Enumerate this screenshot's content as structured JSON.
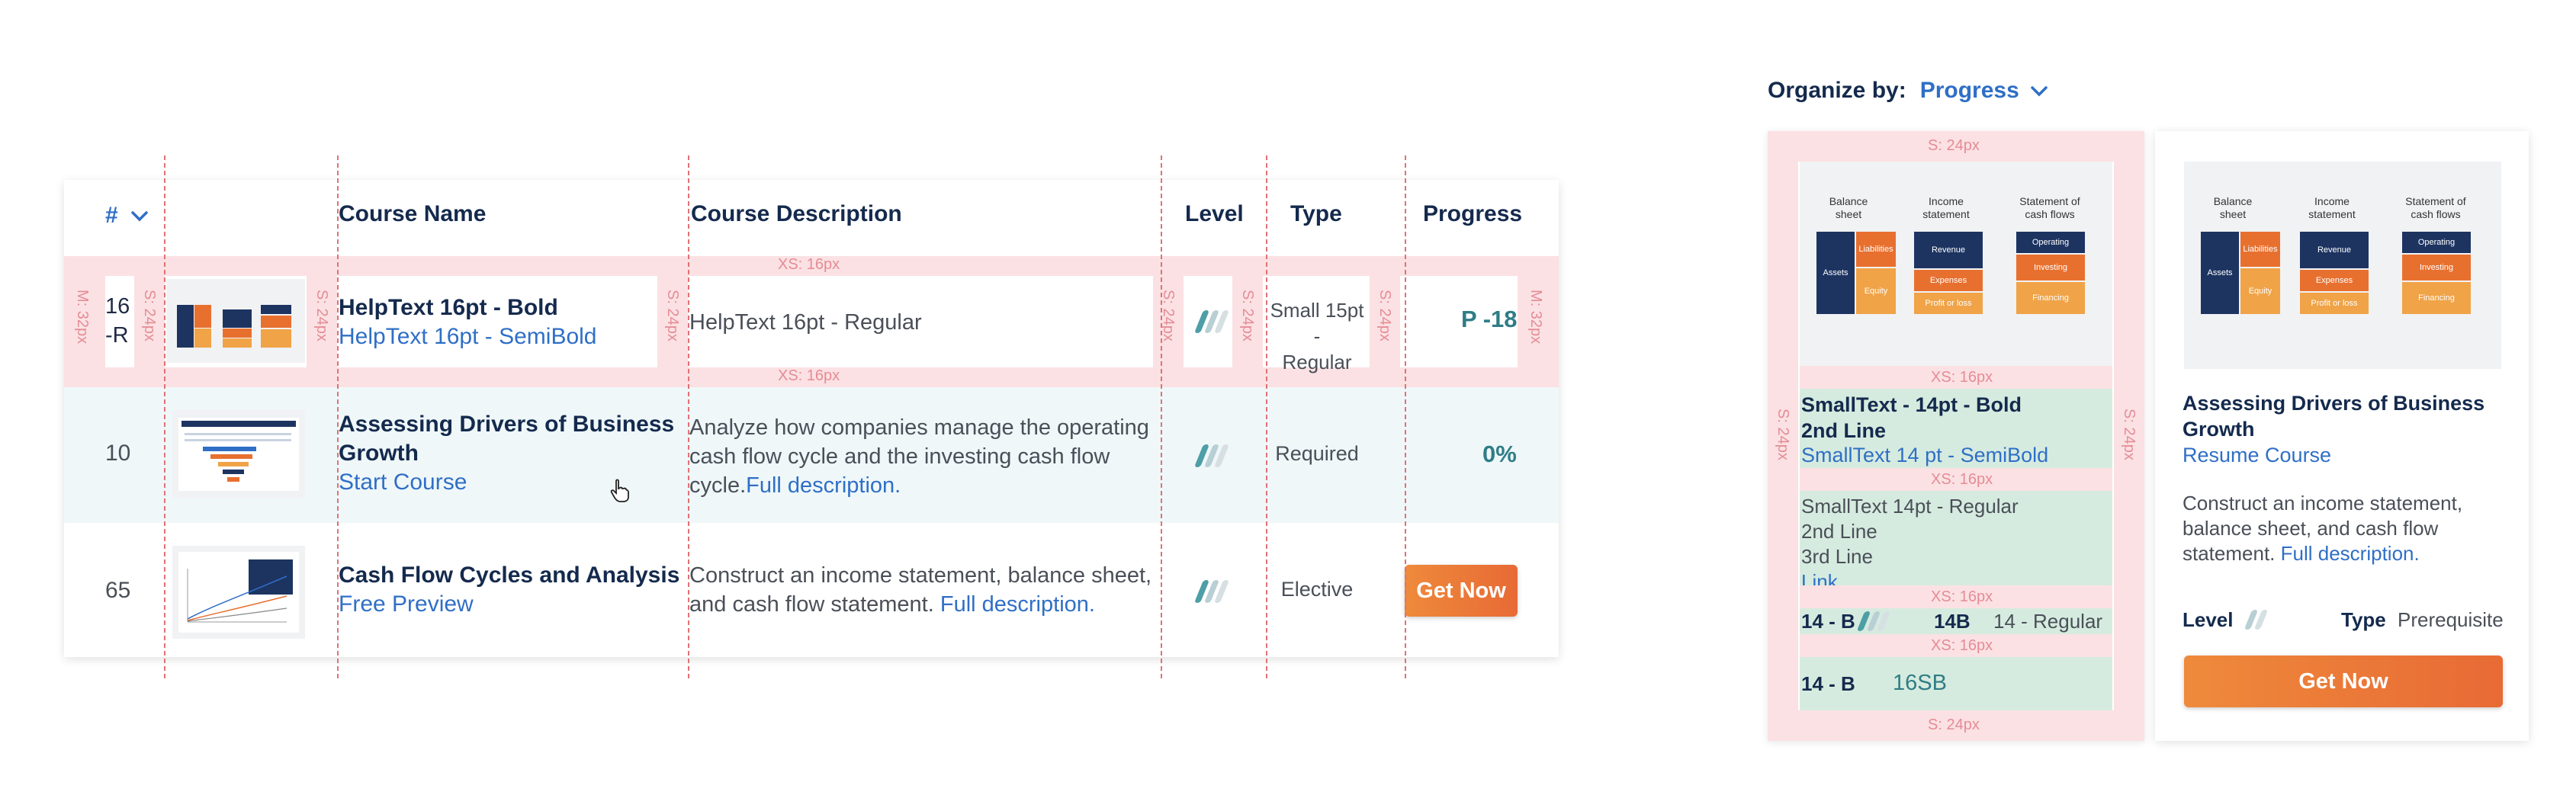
{
  "table": {
    "headers": {
      "index": "#",
      "course_name": "Course Name",
      "description": "Course Description",
      "level": "Level",
      "type": "Type",
      "progress": "Progress"
    },
    "spec_row": {
      "index_line1": "16",
      "index_line2": "-R",
      "name_bold": "HelpText 16pt - Bold",
      "name_link": "HelpText 16pt - SemiBold",
      "description": "HelpText 16pt - Regular",
      "type_line1": "Small 15pt -",
      "type_line2": "Regular",
      "progress": "P -18"
    },
    "rows": [
      {
        "index": "10",
        "title_line1": "Assessing Drivers of Business",
        "title_line2": "Growth",
        "link": "Start Course",
        "desc_line1": "Analyze how companies manage the operating",
        "desc_line2": "cash flow cycle and the investing cash flow",
        "desc_line3": "cycle.",
        "desc_link": "Full description.",
        "type": "Required",
        "progress": "0%"
      },
      {
        "index": "65",
        "title": "Cash Flow Cycles and Analysis",
        "link": "Free Preview",
        "desc_line1": "Construct an income statement, balance sheet,",
        "desc_line2": "and cash flow statement.",
        "desc_link": "Full description.",
        "type": "Elective",
        "button": "Get Now"
      }
    ]
  },
  "spacers": {
    "xs16": "XS: 16px",
    "s24": "S: 24px",
    "m32": "M: 32px"
  },
  "organize": {
    "label": "Organize by:",
    "value": "Progress"
  },
  "thumb_labels": {
    "balance": "Balance sheet",
    "income": "Income statement",
    "cashflows": "Statement of cash flows",
    "assets": "Assets",
    "liabilities": "Liabilities",
    "equity": "Equity",
    "revenue": "Revenue",
    "expenses": "Expenses",
    "profit": "Profit or loss",
    "operating": "Operating",
    "investing": "Investing",
    "financing": "Financing"
  },
  "spec_card": {
    "title_line1": "SmallText - 14pt - Bold",
    "title_line2": "2nd Line",
    "link": "SmallText 14 pt - SemiBold",
    "body_line1": "SmallText 14pt - Regular",
    "body_line2": "2nd Line",
    "body_line3": "3rd Line",
    "body_link": "Link",
    "meta_b1": "14 - B",
    "meta_b2": "14B",
    "meta_r": "14 - Regular",
    "foot_b": "14 - B",
    "foot_sb": "16SB"
  },
  "card": {
    "title_line1": "Assessing Drivers of Business",
    "title_line2": "Growth",
    "link": "Resume Course",
    "desc_line1": "Construct an income statement,",
    "desc_line2": "balance sheet, and cash flow",
    "desc_line3": "statement.",
    "desc_link": "Full description.",
    "level_label": "Level",
    "type_label": "Type",
    "type_value": "Prerequisite",
    "button": "Get Now"
  },
  "colors": {
    "navy": "#142a4d",
    "link_blue": "#2f6fc6",
    "orange": "#ec7a38",
    "teal": "#4d9ea6",
    "pink_spacer": "#fbe1e3",
    "green_spec": "#d6ebdf"
  },
  "icons": {
    "sort": "chevron-down-icon",
    "level": "level-bars-icon",
    "cursor": "hand-pointer-icon"
  }
}
